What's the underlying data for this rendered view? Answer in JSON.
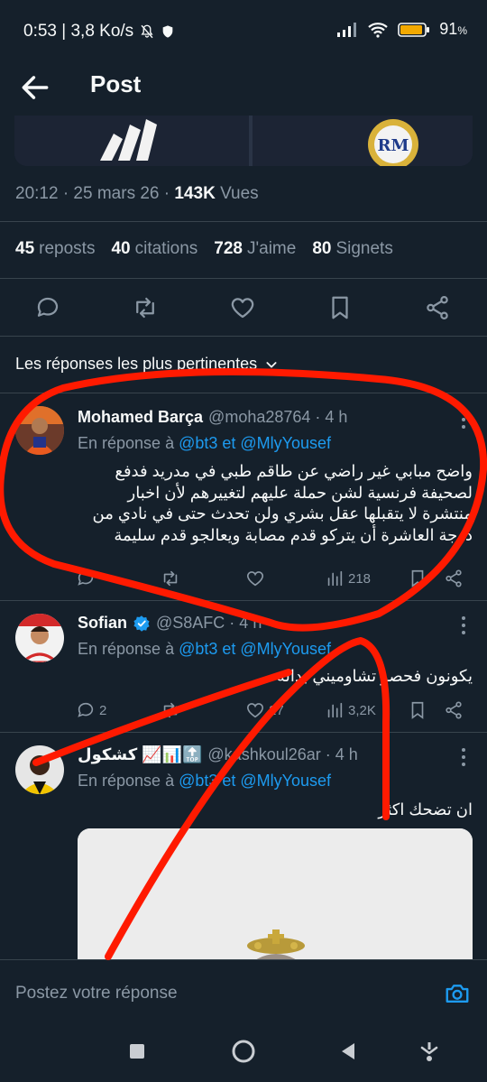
{
  "status": {
    "left": "0:53 | 3,8 Ko/s",
    "battery": "91"
  },
  "header": {
    "title": "Post"
  },
  "post": {
    "time": "20:12 · 25 mars 26 · ",
    "views_num": "143K",
    "views_label": " Vues",
    "stats": [
      {
        "num": "45",
        "label": "reposts"
      },
      {
        "num": "40",
        "label": "citations"
      },
      {
        "num": "728",
        "label": "J'aime"
      },
      {
        "num": "80",
        "label": "Signets"
      }
    ]
  },
  "sort": {
    "label": "Les réponses les plus pertinentes"
  },
  "replies": [
    {
      "name": "Mohamed Barça",
      "handle": "@moha28764 · 4 h",
      "in_reply_prefix": "En réponse à ",
      "in_reply_links": "@bt3 et @MlyYousef",
      "text": "واضح مبابي غير راضي عن طاقم طبي في مدريد فدفع لصحيفة فرنسية لشن حملة عليهم لتغييرهم لأن اخبار منتشرة لا يتقبلها عقل بشري ولن تحدث حتى في نادي من درجة العاشرة أن يتركو قدم مصابة ويعالجو قدم سليمة",
      "replies": "",
      "retweets": "",
      "likes": "",
      "views": "218"
    },
    {
      "name": "Sofian",
      "handle": "@S8AFC · 4 h",
      "in_reply_prefix": "En réponse à ",
      "in_reply_links": "@bt3 et @MlyYousef",
      "text": "يكونون فحصو تشاوميني بداله",
      "replies": "2",
      "retweets": "",
      "likes": "27",
      "views": "3,2K"
    },
    {
      "name": "كشكول 📈📊🔝",
      "handle": "@kashkoul26ar · 4 h",
      "in_reply_prefix": "En réponse à ",
      "in_reply_links": "@bt3 et @MlyYousef",
      "text": "ان تضحك اكثر",
      "replies": "",
      "retweets": "",
      "likes": "",
      "views": ""
    }
  ],
  "composer": {
    "placeholder": "Postez votre réponse"
  },
  "colors": {
    "bg": "#15202b",
    "accent": "#1d9bf0",
    "annotation": "#ff1a00",
    "muted": "#8b98a5"
  },
  "icons": [
    "back-arrow-icon",
    "reply-icon",
    "retweet-icon",
    "like-icon",
    "bookmark-icon",
    "share-icon",
    "views-icon",
    "more-icon",
    "camera-icon",
    "verified-icon"
  ]
}
